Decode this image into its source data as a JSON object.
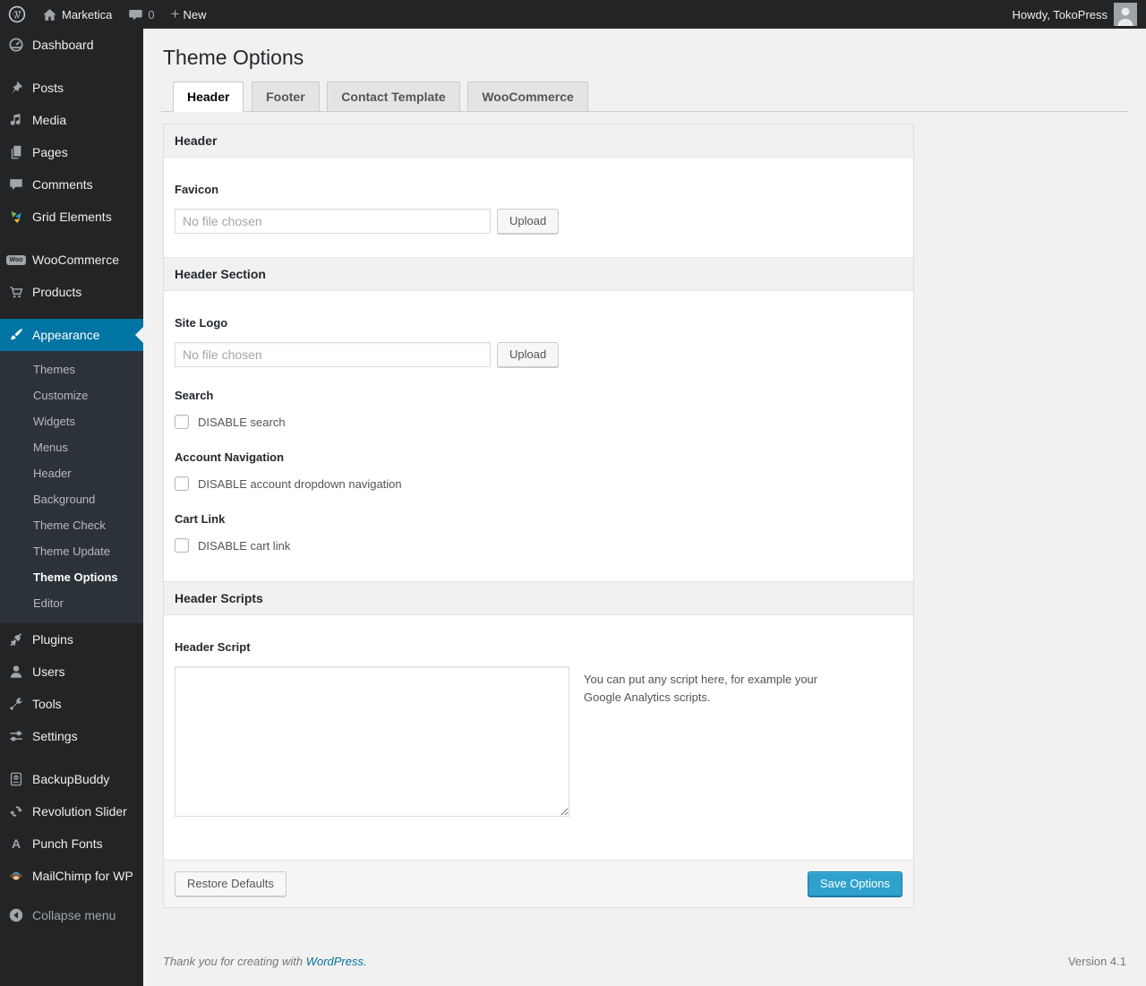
{
  "admin_bar": {
    "wordpress_logo_icon": "wordpress-logo-icon",
    "home_icon": "home-icon",
    "site_name": "Marketica",
    "comments_icon": "comment-bubble-icon",
    "comment_count": "0",
    "plus_icon": "plus-icon",
    "new_label": "New",
    "howdy_label": "Howdy, TokoPress",
    "avatar_icon": "user-avatar-icon"
  },
  "sidebar": {
    "items": [
      {
        "label": "Dashboard",
        "icon": "dashboard-icon"
      },
      {
        "label": "Posts",
        "icon": "pushpin-icon"
      },
      {
        "label": "Media",
        "icon": "media-icon"
      },
      {
        "label": "Pages",
        "icon": "pages-icon"
      },
      {
        "label": "Comments",
        "icon": "comments-icon"
      },
      {
        "label": "Grid Elements",
        "icon": "grid-elements-icon"
      },
      {
        "label": "WooCommerce",
        "icon": "woocommerce-badge-icon"
      },
      {
        "label": "Products",
        "icon": "cart-icon"
      },
      {
        "label": "Appearance",
        "icon": "paintbrush-icon",
        "active": true
      },
      {
        "label": "Plugins",
        "icon": "plugin-icon"
      },
      {
        "label": "Users",
        "icon": "user-icon"
      },
      {
        "label": "Tools",
        "icon": "wrench-icon"
      },
      {
        "label": "Settings",
        "icon": "settings-sliders-icon"
      },
      {
        "label": "BackupBuddy",
        "icon": "backup-drive-icon"
      },
      {
        "label": "Revolution Slider",
        "icon": "cycle-arrows-icon"
      },
      {
        "label": "Punch Fonts",
        "icon": "letter-a-icon"
      },
      {
        "label": "MailChimp for WP",
        "icon": "monkey-icon"
      },
      {
        "label": "Collapse menu",
        "icon": "collapse-arrow-icon"
      }
    ],
    "appearance_submenu": [
      {
        "label": "Themes"
      },
      {
        "label": "Customize"
      },
      {
        "label": "Widgets"
      },
      {
        "label": "Menus"
      },
      {
        "label": "Header"
      },
      {
        "label": "Background"
      },
      {
        "label": "Theme Check"
      },
      {
        "label": "Theme Update"
      },
      {
        "label": "Theme Options",
        "current": true
      },
      {
        "label": "Editor"
      }
    ]
  },
  "main": {
    "title": "Theme Options",
    "tabs": [
      {
        "label": "Header",
        "active": true
      },
      {
        "label": "Footer",
        "active": false
      },
      {
        "label": "Contact Template",
        "active": false
      },
      {
        "label": "WooCommerce",
        "active": false
      }
    ],
    "panel": {
      "sections": [
        {
          "title": "Header"
        },
        {
          "title": "Header Section"
        },
        {
          "title": "Header Scripts"
        }
      ],
      "favicon": {
        "label": "Favicon",
        "value": "",
        "placeholder": "No file chosen",
        "button": "Upload"
      },
      "site_logo": {
        "label": "Site Logo",
        "value": "",
        "placeholder": "No file chosen",
        "button": "Upload"
      },
      "search": {
        "label": "Search",
        "checkbox_label": "DISABLE search",
        "checked": false
      },
      "account_navigation": {
        "label": "Account Navigation",
        "checkbox_label": "DISABLE account dropdown navigation",
        "checked": false
      },
      "cart_link": {
        "label": "Cart Link",
        "checkbox_label": "DISABLE cart link",
        "checked": false
      },
      "header_script": {
        "label": "Header Script",
        "value": "",
        "description": "You can put any script here, for example your Google Analytics scripts."
      },
      "buttons": {
        "restore": "Restore Defaults",
        "save": "Save Options"
      }
    }
  },
  "footer": {
    "thanks_text": "Thank you for creating with",
    "wordpress_link": "WordPress.",
    "version": "Version 4.1"
  },
  "colors": {
    "menu_dark": "#222426",
    "submenu_dark": "#2c3338",
    "accent_blue": "#0074a2",
    "primary_button": "#2ea2cc",
    "page_bg": "#f1f1f1",
    "link": "#0074a2"
  }
}
